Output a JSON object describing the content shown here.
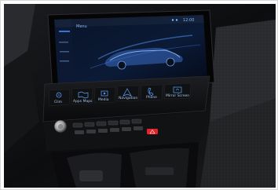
{
  "scene": {
    "subject": "car-interior-infotainment-dashboard"
  },
  "screen": {
    "status_time": "12:00",
    "menu_title": "Menu"
  },
  "touch_bar": {
    "items": [
      {
        "label": "Clim",
        "icon": "fan-icon"
      },
      {
        "label": "Apps Maps",
        "icon": "map-icon"
      },
      {
        "label": "Media",
        "icon": "media-icon"
      },
      {
        "label": "Navigation",
        "icon": "navigation-icon"
      },
      {
        "label": "Phone",
        "icon": "phone-icon"
      },
      {
        "label": "Mirror Screen",
        "icon": "mirror-screen-icon"
      }
    ]
  },
  "colors": {
    "accent_blue": "#3d8bff",
    "hazard_red": "#e5222a",
    "dash_black": "#0f1012"
  }
}
